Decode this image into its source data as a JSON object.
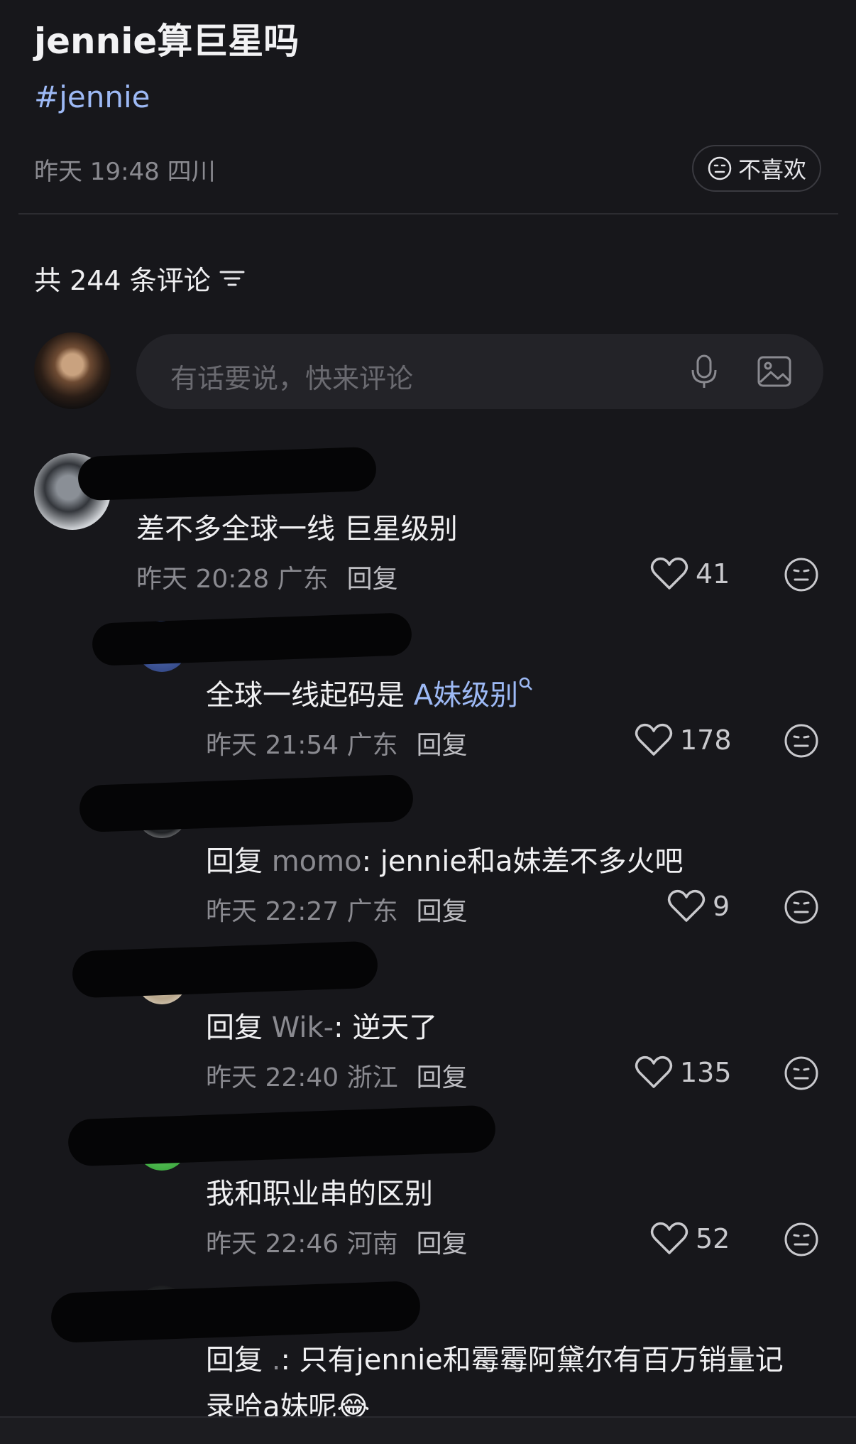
{
  "post": {
    "title": "jennie算巨星吗",
    "tag": "#jennie",
    "meta": "昨天 19:48 四川",
    "dislike_label": "不喜欢"
  },
  "comments_header": {
    "count_label": "共 244 条评论"
  },
  "composer": {
    "placeholder": "有话要说，快来评论"
  },
  "comments": [
    {
      "prefix": "",
      "name": "",
      "sep": "",
      "text": "差不多全球一线 巨星级别",
      "meta": "昨天 20:28 广东",
      "reply": "回复",
      "likes": "41"
    },
    {
      "prefix": "",
      "name": "",
      "sep": "",
      "text": "全球一线起码是 ",
      "link": "A妹级别",
      "meta": "昨天 21:54 广东",
      "reply": "回复",
      "likes": "178"
    },
    {
      "prefix": "回复 ",
      "name": "momo",
      "sep": ": ",
      "text": "jennie和a妹差不多火吧",
      "meta": "昨天 22:27 广东",
      "reply": "回复",
      "likes": "9"
    },
    {
      "prefix": "回复 ",
      "name": "Wik-",
      "sep": ": ",
      "text": "逆天了",
      "meta": "昨天 22:40 浙江",
      "reply": "回复",
      "likes": "135"
    },
    {
      "prefix": "",
      "name": "",
      "sep": "",
      "text": "我和职业串的区别",
      "meta": "昨天 22:46 河南",
      "reply": "回复",
      "likes": "52"
    },
    {
      "prefix": "回复 ",
      "name": ".",
      "sep": ": ",
      "text": "只有jennie和霉霉阿黛尔有百万销量记",
      "text2": "录哈a妹呢",
      "emoji": "😂"
    }
  ],
  "colors": {
    "background": "#17171b",
    "link": "#9db9f5",
    "muted": "#8a8a90"
  }
}
